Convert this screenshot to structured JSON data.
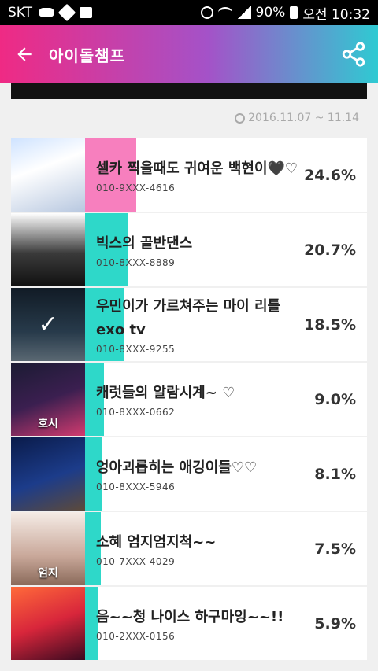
{
  "status_bar": {
    "carrier": "SKT",
    "battery": "90%",
    "time": "오전 10:32"
  },
  "header": {
    "title": "아이돌챔프",
    "back_icon": "arrow-left-icon",
    "share_icon": "share-icon"
  },
  "date_range": "2016.11.07 ~ 11.14",
  "colors": {
    "pink": "#f77fbe",
    "teal": "#2ed8c9"
  },
  "items": [
    {
      "title": "셀카 찍을때도 귀여운 백현이🖤♡",
      "phone": "010-9XXX-4616",
      "percent": "24.6%",
      "value": 24.6,
      "bar_color": "pink",
      "checked": false,
      "thumb_label": ""
    },
    {
      "title": "빅스의 골반댄스",
      "phone": "010-8XXX-8889",
      "percent": "20.7%",
      "value": 20.7,
      "bar_color": "teal",
      "checked": false,
      "thumb_label": ""
    },
    {
      "title": "우민이가 가르쳐주는 마이 리틀 exo tv",
      "phone": "010-8XXX-9255",
      "percent": "18.5%",
      "value": 18.5,
      "bar_color": "teal",
      "checked": true,
      "thumb_label": ""
    },
    {
      "title": "캐럿들의 알람시계~ ♡",
      "phone": "010-8XXX-0662",
      "percent": "9.0%",
      "value": 9.0,
      "bar_color": "teal",
      "checked": false,
      "thumb_label": "호시"
    },
    {
      "title": "엉아괴롭히는 애깅이들♡♡",
      "phone": "010-8XXX-5946",
      "percent": "8.1%",
      "value": 8.1,
      "bar_color": "teal",
      "checked": false,
      "thumb_label": ""
    },
    {
      "title": "소혜 엄지엄지척~~",
      "phone": "010-7XXX-4029",
      "percent": "7.5%",
      "value": 7.5,
      "bar_color": "teal",
      "checked": false,
      "thumb_label": "엄지"
    },
    {
      "title": "음~~청 나이스 하구마잉~~!!",
      "phone": "010-2XXX-0156",
      "percent": "5.9%",
      "value": 5.9,
      "bar_color": "teal",
      "checked": false,
      "thumb_label": ""
    }
  ]
}
